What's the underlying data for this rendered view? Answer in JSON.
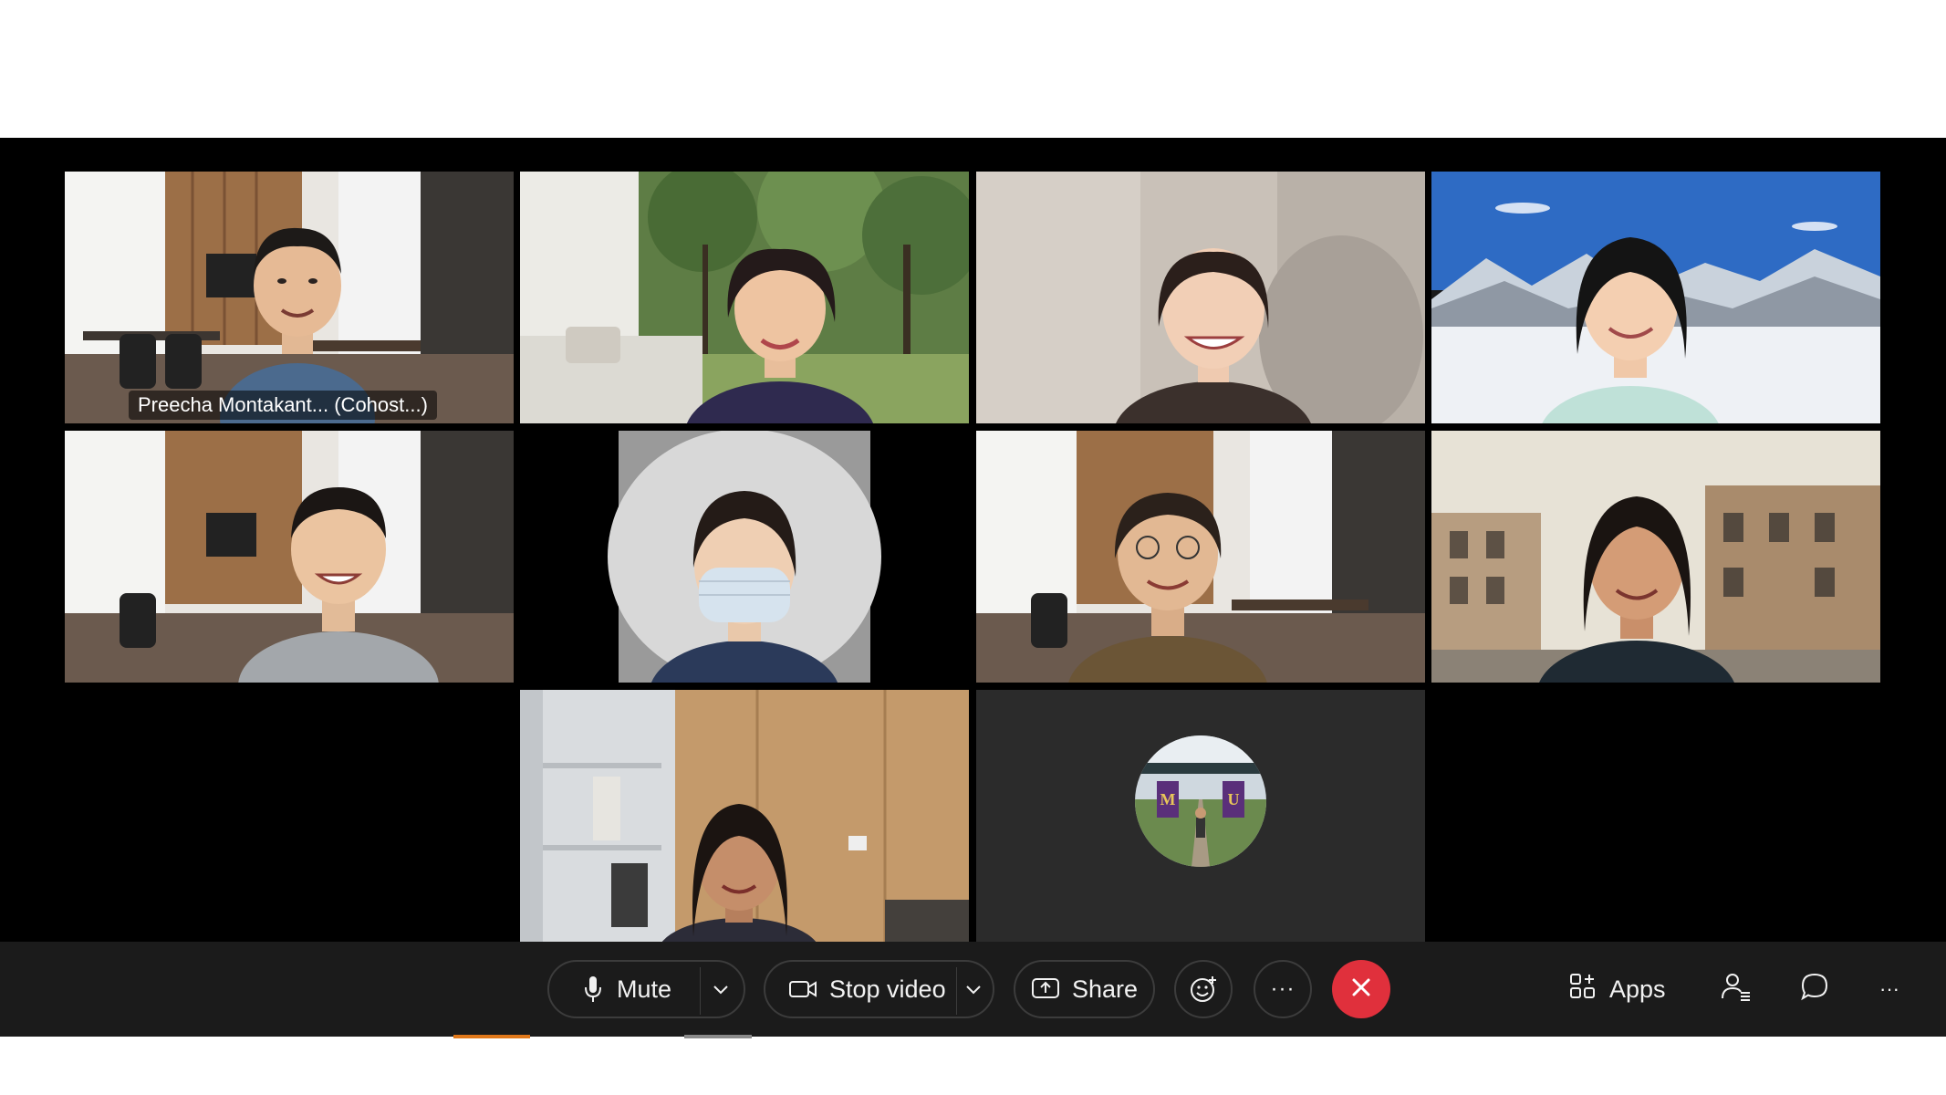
{
  "meeting": {
    "participants": [
      {
        "name_label": "Preecha Montakant... (Cohost...)",
        "is_active_speaker": true
      },
      {
        "name_label": ""
      },
      {
        "name_label": ""
      },
      {
        "name_label": ""
      },
      {
        "name_label": ""
      },
      {
        "name_label": ""
      },
      {
        "name_label": ""
      },
      {
        "name_label": ""
      },
      {
        "name_label": ""
      },
      {
        "name_label": "",
        "avatar_letters": [
          "M",
          "U"
        ]
      }
    ]
  },
  "toolbar": {
    "mute_label": "Mute",
    "stop_video_label": "Stop video",
    "share_label": "Share",
    "more_label": "···",
    "apps_label": "Apps",
    "overflow_label": "···"
  },
  "colors": {
    "active_border": "#1ea8e0",
    "end_call": "#e0303c",
    "toolbar_bg": "#1b1b1b",
    "window_bg": "#000000"
  },
  "icons": [
    "microphone-icon",
    "chevron-down-icon",
    "video-camera-icon",
    "share-screen-icon",
    "reactions-icon",
    "more-options-icon",
    "end-call-icon",
    "apps-icon",
    "participants-icon",
    "chat-icon",
    "overflow-icon"
  ]
}
